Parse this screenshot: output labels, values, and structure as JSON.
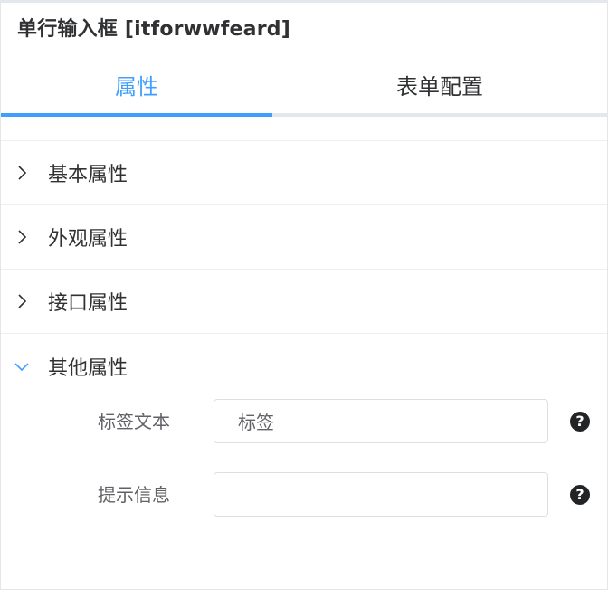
{
  "header": {
    "title": "单行输入框 [itforwwfeard]"
  },
  "tabs": [
    {
      "label": "属性",
      "active": true
    },
    {
      "label": "表单配置",
      "active": false
    }
  ],
  "sections": [
    {
      "label": "基本属性",
      "expanded": false,
      "icon": "chevron-right-icon"
    },
    {
      "label": "外观属性",
      "expanded": false,
      "icon": "chevron-right-icon"
    },
    {
      "label": "接口属性",
      "expanded": false,
      "icon": "chevron-right-icon"
    },
    {
      "label": "其他属性",
      "expanded": true,
      "icon": "chevron-down-icon"
    }
  ],
  "form": {
    "label_text": {
      "label": "标签文本",
      "value": "标签",
      "help_icon": "question-circle-icon"
    },
    "hint_info": {
      "label": "提示信息",
      "value": "",
      "help_icon": "question-circle-icon"
    }
  },
  "colors": {
    "accent": "#409eff",
    "text": "#303133",
    "border": "#dcdfe6"
  }
}
